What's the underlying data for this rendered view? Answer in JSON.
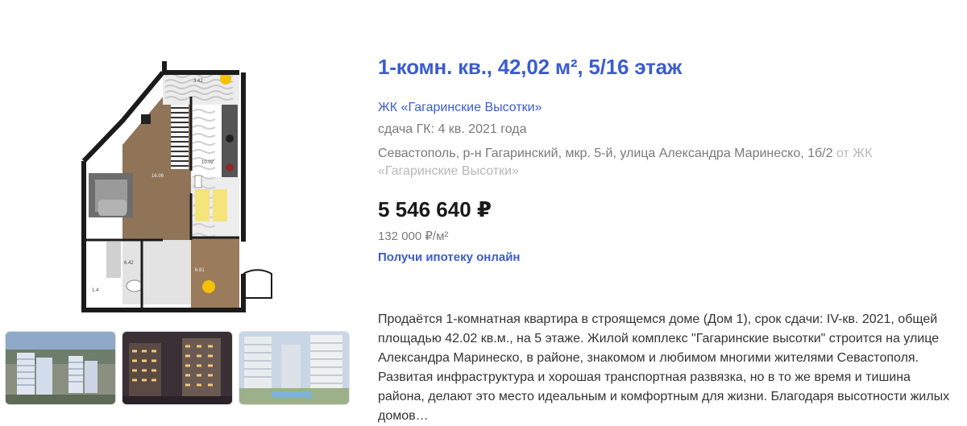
{
  "listing": {
    "title": "1-комн. кв., 42,02 м², 5/16 этаж",
    "complex_link": "ЖК «Гагаринские Высотки»",
    "handover": "сдача ГК: 4 кв. 2021 года",
    "address": "Севастополь, р-н Гагаринский, мкр. 5-й, улица Александра Маринеско, 1б/2",
    "address_from": "от ЖК «Гагаринские Высотки»",
    "price": "5 546 640 ₽",
    "price_per_m2": "132 000 ₽/м²",
    "mortgage_link": "Получи ипотеку онлайн",
    "description": "Продаётся 1-комнатная квартира в строящемся доме (Дом 1), срок сдачи: IV-кв. 2021, общей площадью 42.02 кв.м., на 5 этаже. Жилой комплекс \"Гагаринские высотки\" строится на улице Александра Маринеско, в районе, знакомом и любимом многими жителями Севастополя. Развитая инфраструктура и хорошая транспортная развязка, но в то же время и тишина района, делают это место идеальным и комфортным для жизни. Благодаря высотности жилых домов…"
  },
  "floorplan": {
    "rooms": {
      "balcony": "3.42",
      "living": "16.06",
      "kitchen": "10.02",
      "bath": "6.42",
      "hall": "6.81",
      "storage": "1.4"
    }
  },
  "thumbnails": [
    {
      "name": "complex-aerial-photo"
    },
    {
      "name": "complex-night-photo"
    },
    {
      "name": "complex-courtyard-photo"
    }
  ],
  "colors": {
    "link": "#3c5ccf",
    "muted": "#7a7a7a",
    "price": "#1a1a1a"
  }
}
